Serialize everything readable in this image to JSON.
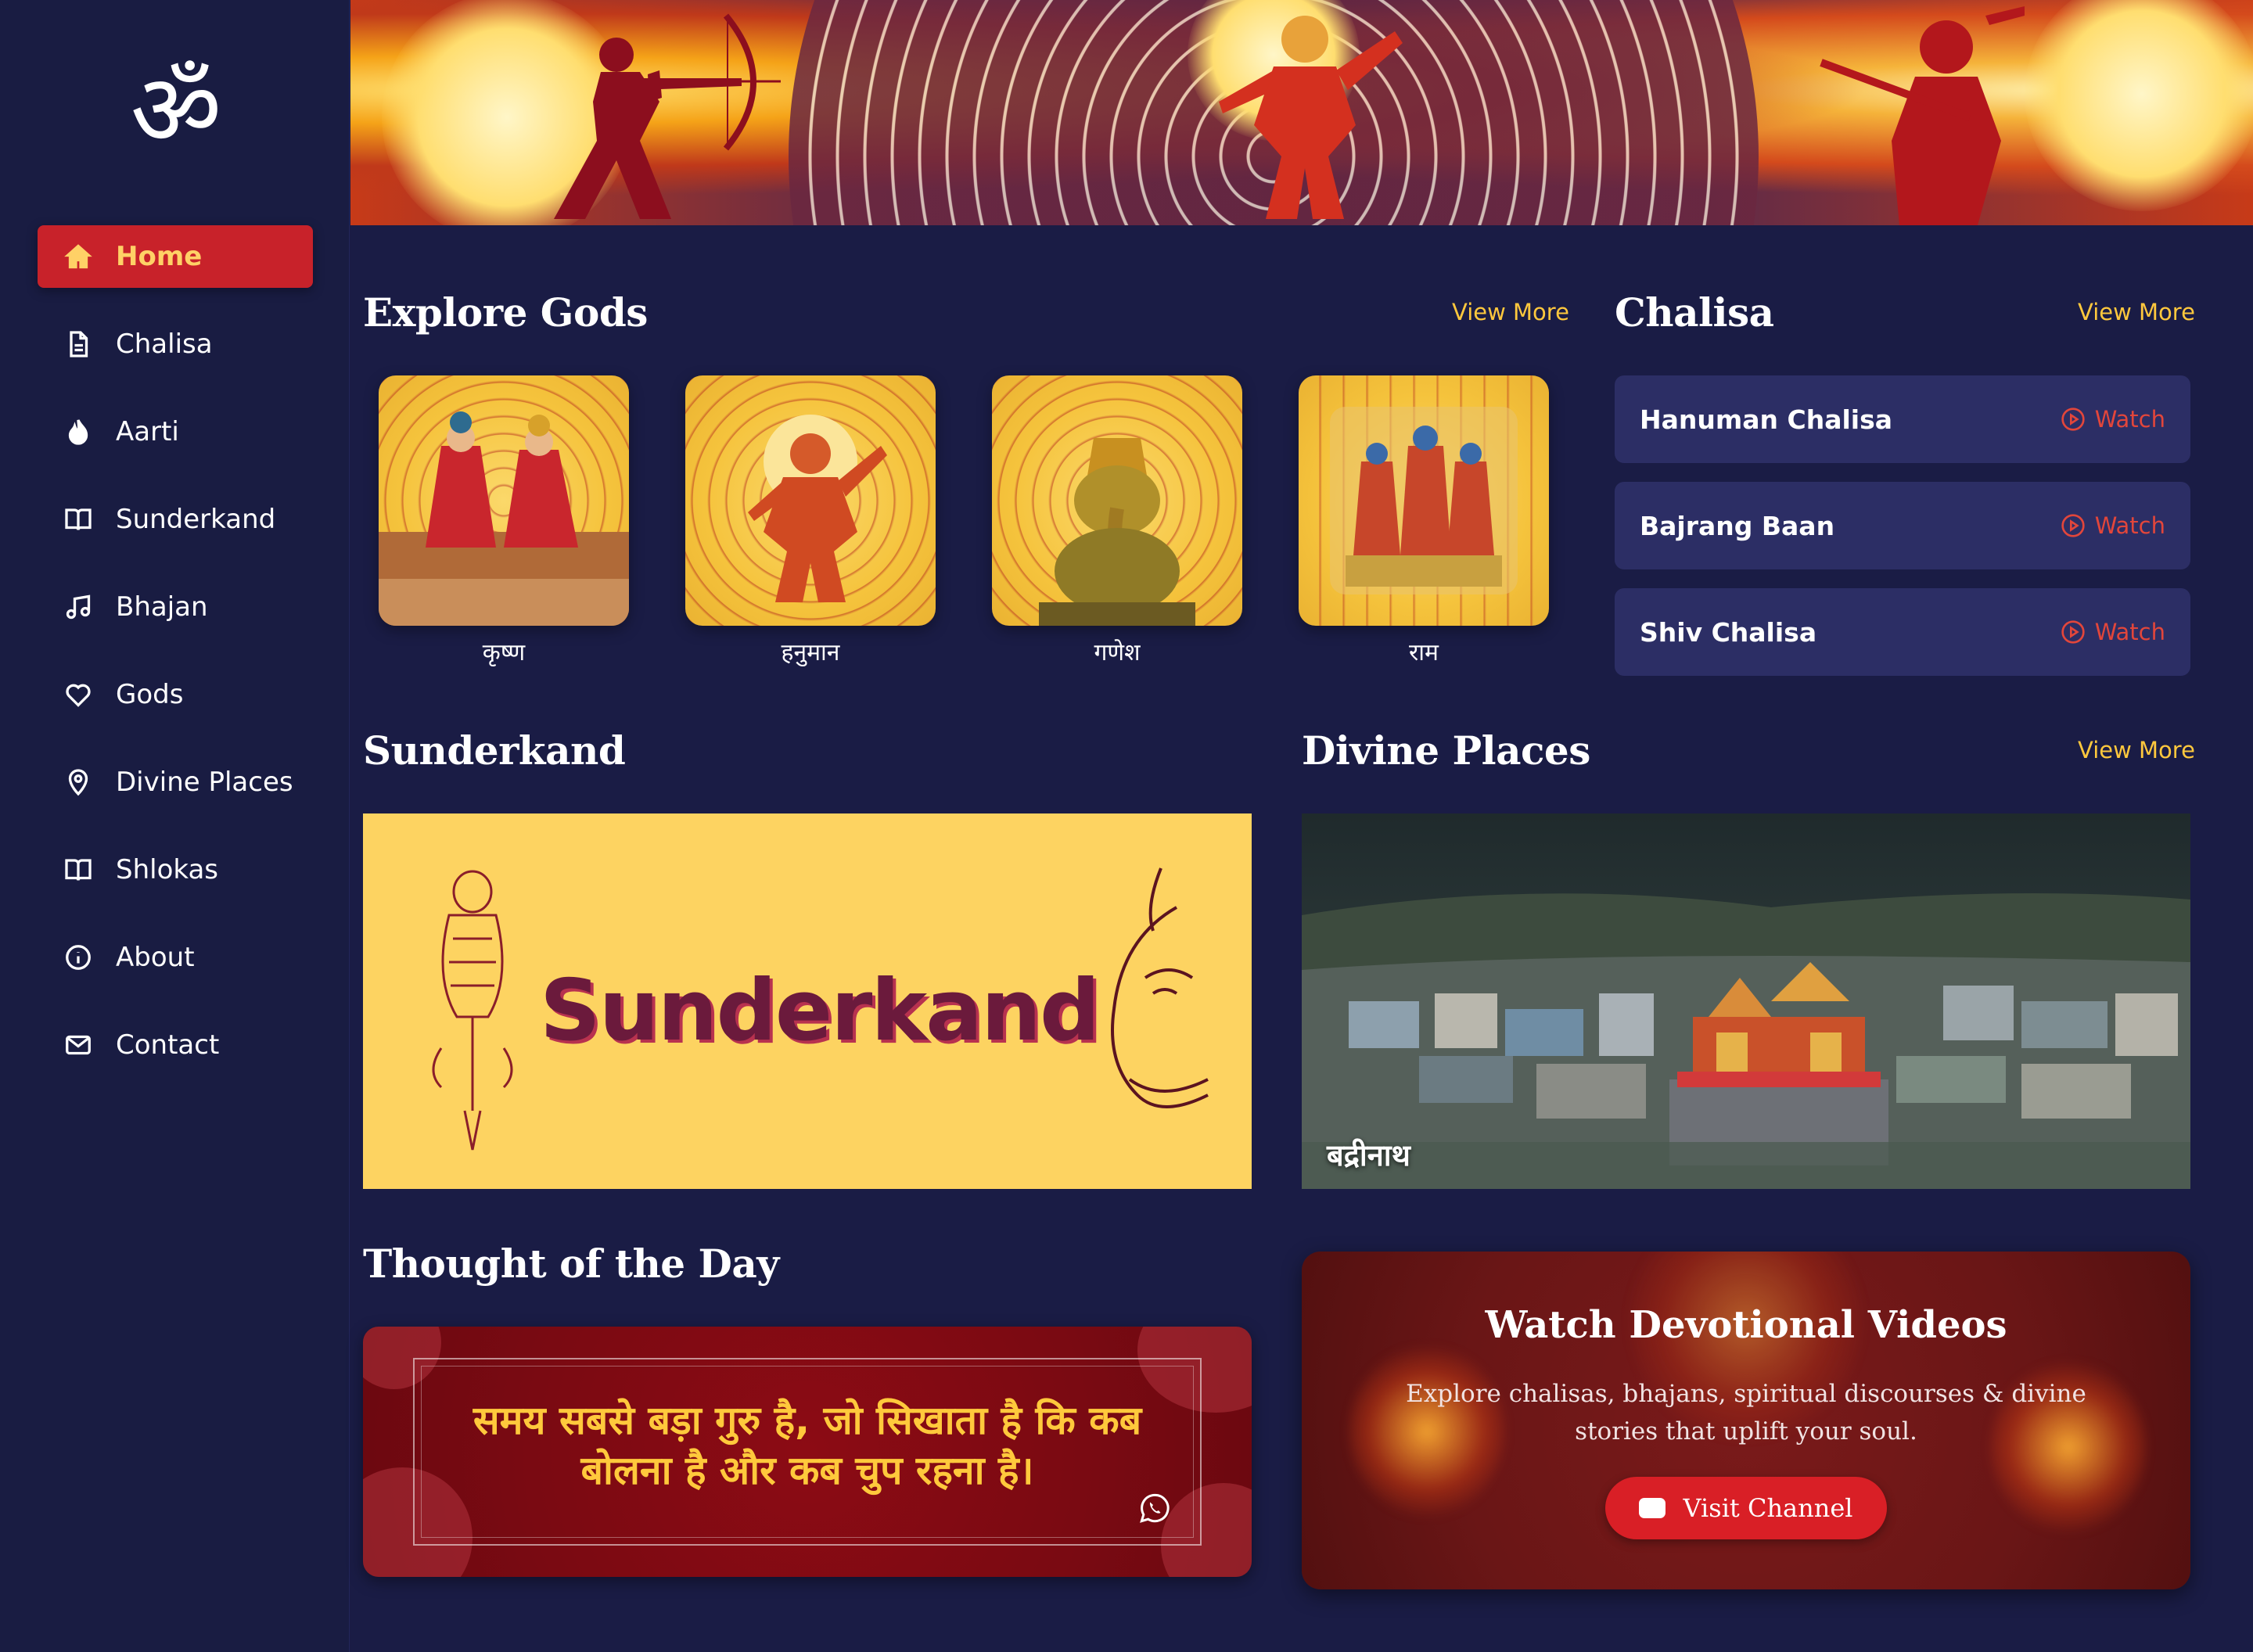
{
  "sidebar": {
    "logo_glyph": "ॐ",
    "items": [
      {
        "label": "Home",
        "icon": "home-icon",
        "active": true
      },
      {
        "label": "Chalisa",
        "icon": "document-icon"
      },
      {
        "label": "Aarti",
        "icon": "flame-icon"
      },
      {
        "label": "Sunderkand",
        "icon": "book-open-icon"
      },
      {
        "label": "Bhajan",
        "icon": "music-note-icon"
      },
      {
        "label": "Gods",
        "icon": "heart-icon"
      },
      {
        "label": "Divine Places",
        "icon": "map-pin-icon"
      },
      {
        "label": "Shlokas",
        "icon": "book-open-icon"
      },
      {
        "label": "About",
        "icon": "info-icon"
      },
      {
        "label": "Contact",
        "icon": "mail-icon"
      }
    ]
  },
  "explore_gods": {
    "title": "Explore Gods",
    "view_more": "View More",
    "gods": [
      "कृष्ण",
      "हनुमान",
      "गणेश",
      "राम"
    ]
  },
  "chalisa": {
    "title": "Chalisa",
    "view_more": "View More",
    "items": [
      {
        "title": "Hanuman Chalisa",
        "action": "Watch"
      },
      {
        "title": "Bajrang Baan",
        "action": "Watch"
      },
      {
        "title": "Shiv Chalisa",
        "action": "Watch"
      }
    ]
  },
  "sunderkand": {
    "title": "Sunderkand",
    "banner_text": "Sunderkand"
  },
  "divine_places": {
    "title": "Divine Places",
    "view_more": "View More",
    "place": "बद्रीनाथ"
  },
  "thought": {
    "title": "Thought of the Day",
    "quote": "समय सबसे बड़ा गुरु है, जो सिखाता है कि कब बोलना है और कब चुप रहना है।"
  },
  "videos": {
    "title": "Watch Devotional Videos",
    "description": "Explore chalisas, bhajans, spiritual discourses & divine stories that uplift your soul.",
    "button": "Visit Channel"
  },
  "colors": {
    "background": "#1a1c45",
    "accent_red": "#c8222a",
    "accent_yellow": "#ffc83d",
    "card": "#2c2e65"
  }
}
